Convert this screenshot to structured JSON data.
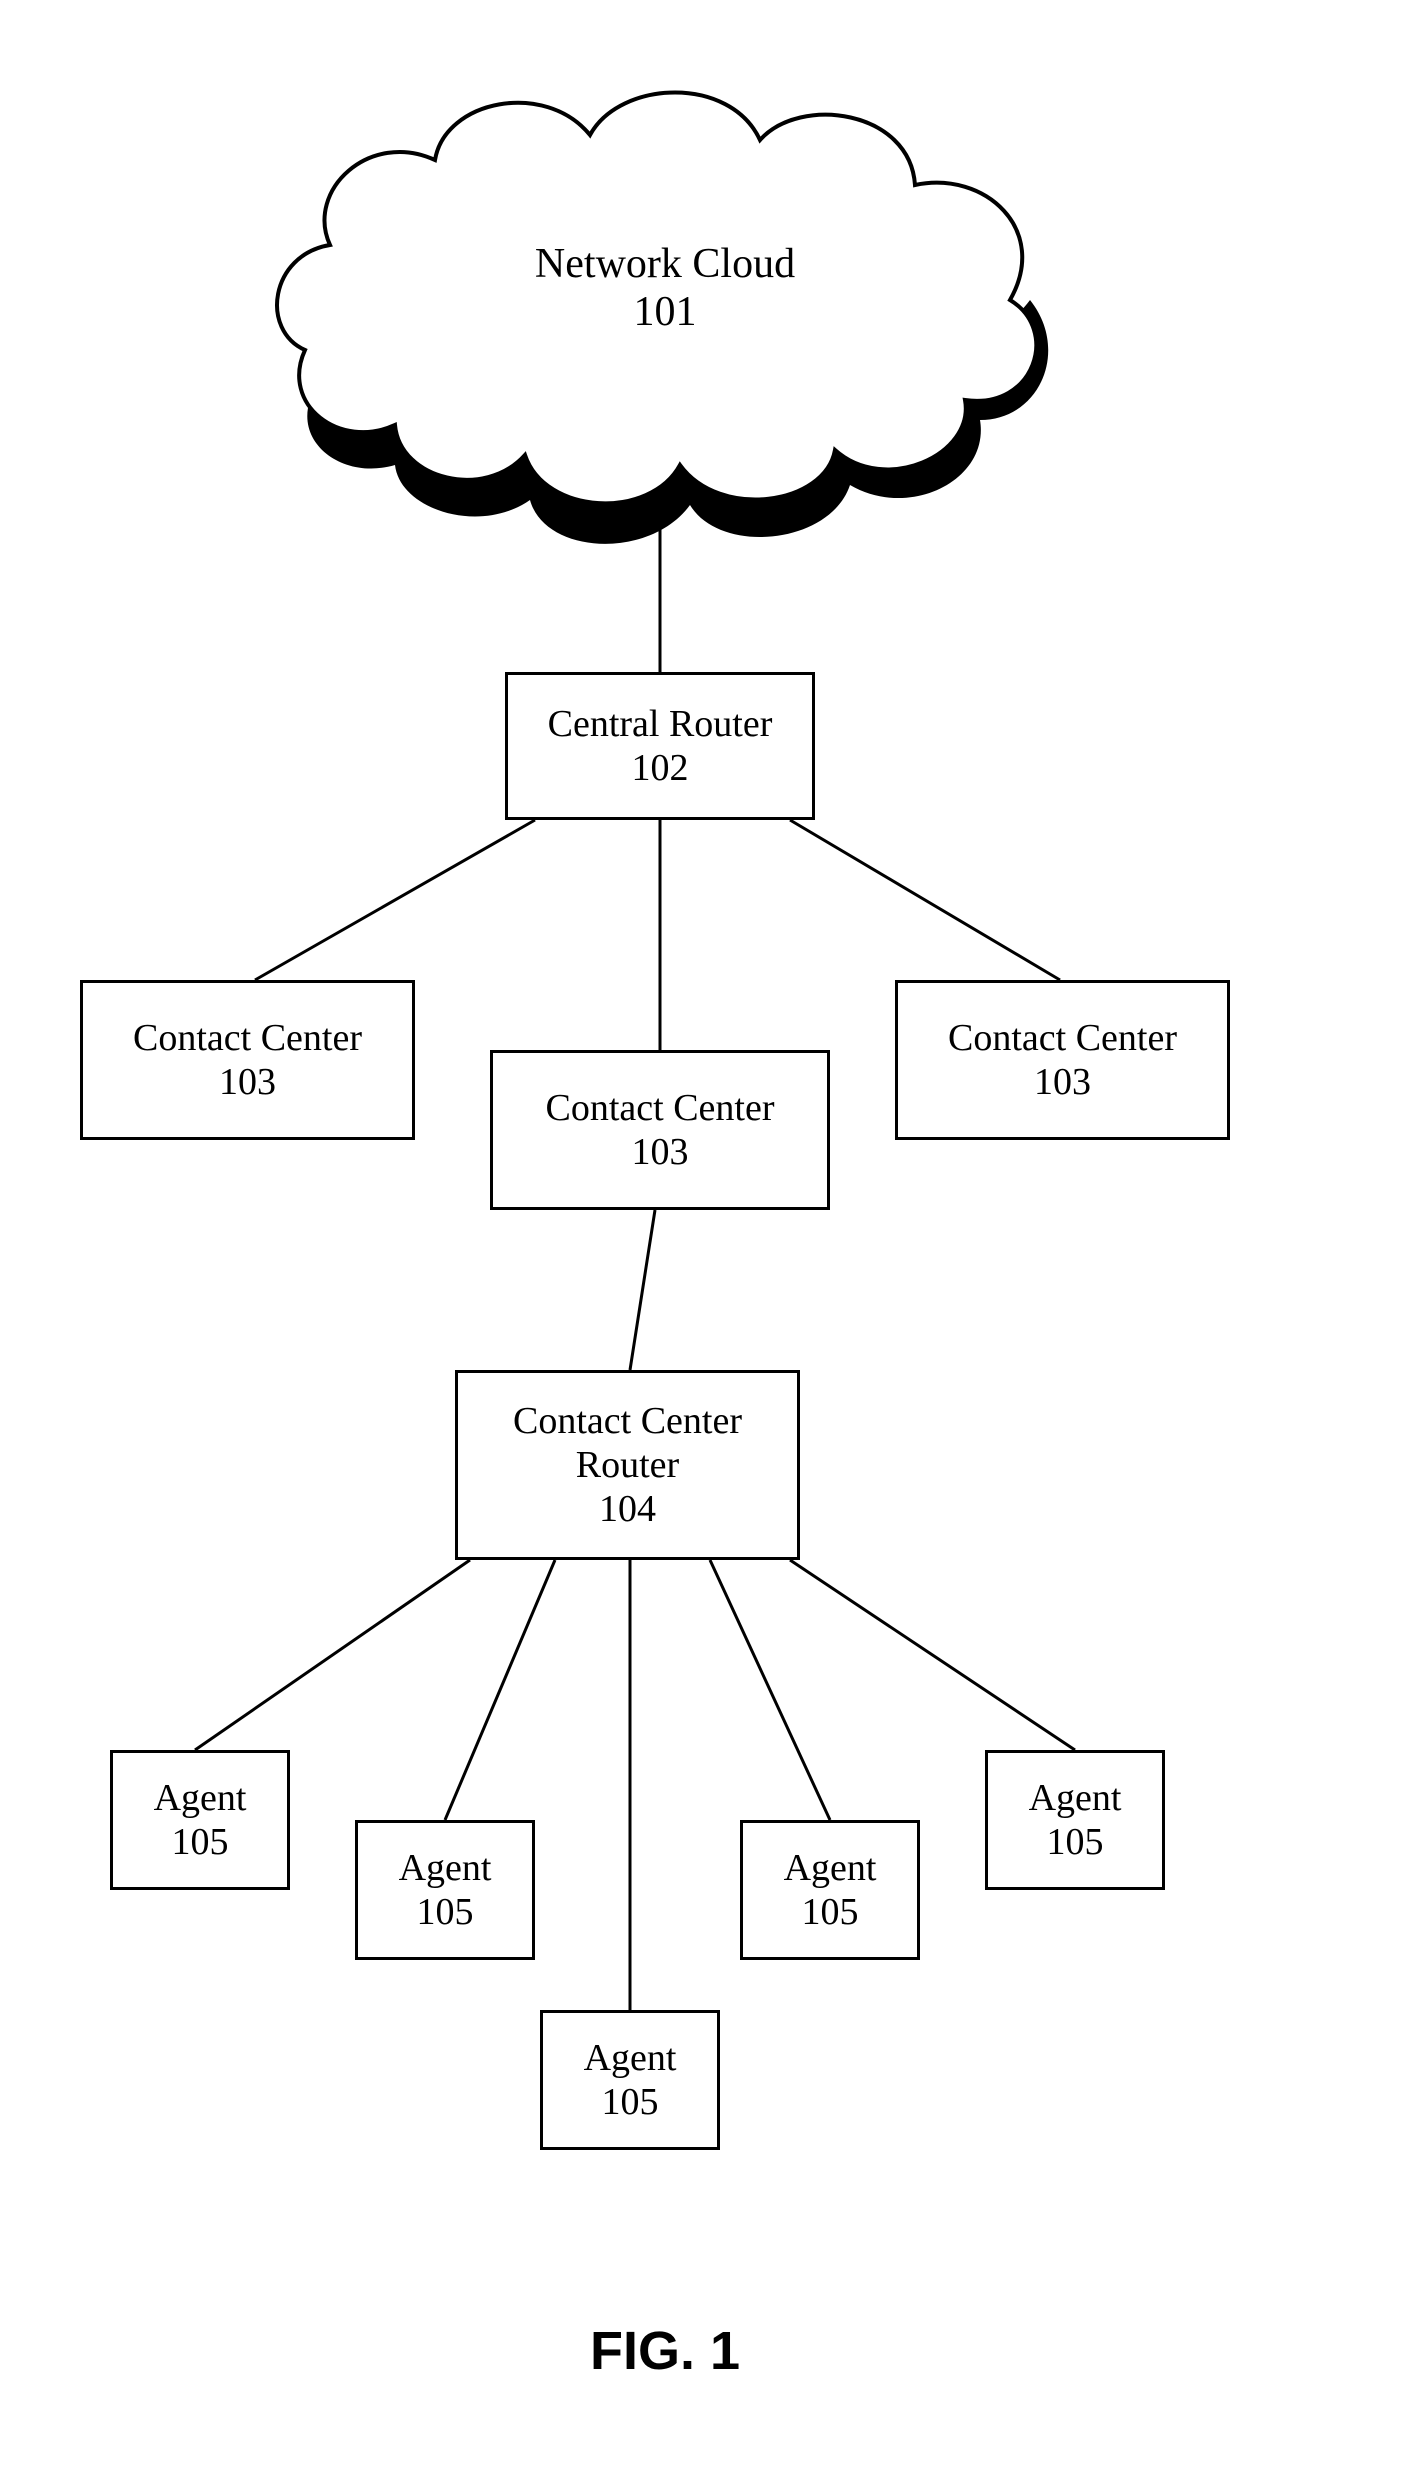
{
  "nodes": {
    "cloud": {
      "title": "Network Cloud",
      "ref": "101"
    },
    "router": {
      "title": "Central Router",
      "ref": "102"
    },
    "cc_left": {
      "title": "Contact Center",
      "ref": "103"
    },
    "cc_mid": {
      "title": "Contact Center",
      "ref": "103"
    },
    "cc_right": {
      "title": "Contact Center",
      "ref": "103"
    },
    "cc_router": {
      "title": "Contact Center Router",
      "ref": "104"
    },
    "agent1": {
      "title": "Agent",
      "ref": "105"
    },
    "agent2": {
      "title": "Agent",
      "ref": "105"
    },
    "agent3": {
      "title": "Agent",
      "ref": "105"
    },
    "agent4": {
      "title": "Agent",
      "ref": "105"
    },
    "agent5": {
      "title": "Agent",
      "ref": "105"
    }
  },
  "caption": "FIG. 1",
  "chart_data": {
    "type": "tree-diagram",
    "nodes": [
      {
        "id": "101",
        "label": "Network Cloud",
        "shape": "cloud"
      },
      {
        "id": "102",
        "label": "Central Router",
        "shape": "box"
      },
      {
        "id": "103a",
        "label": "Contact Center",
        "shape": "box"
      },
      {
        "id": "103b",
        "label": "Contact Center",
        "shape": "box"
      },
      {
        "id": "103c",
        "label": "Contact Center",
        "shape": "box"
      },
      {
        "id": "104",
        "label": "Contact Center Router",
        "shape": "box"
      },
      {
        "id": "105a",
        "label": "Agent",
        "shape": "box"
      },
      {
        "id": "105b",
        "label": "Agent",
        "shape": "box"
      },
      {
        "id": "105c",
        "label": "Agent",
        "shape": "box"
      },
      {
        "id": "105d",
        "label": "Agent",
        "shape": "box"
      },
      {
        "id": "105e",
        "label": "Agent",
        "shape": "box"
      }
    ],
    "edges": [
      [
        "101",
        "102"
      ],
      [
        "102",
        "103a"
      ],
      [
        "102",
        "103b"
      ],
      [
        "102",
        "103c"
      ],
      [
        "103b",
        "104"
      ],
      [
        "104",
        "105a"
      ],
      [
        "104",
        "105b"
      ],
      [
        "104",
        "105c"
      ],
      [
        "104",
        "105d"
      ],
      [
        "104",
        "105e"
      ]
    ]
  }
}
